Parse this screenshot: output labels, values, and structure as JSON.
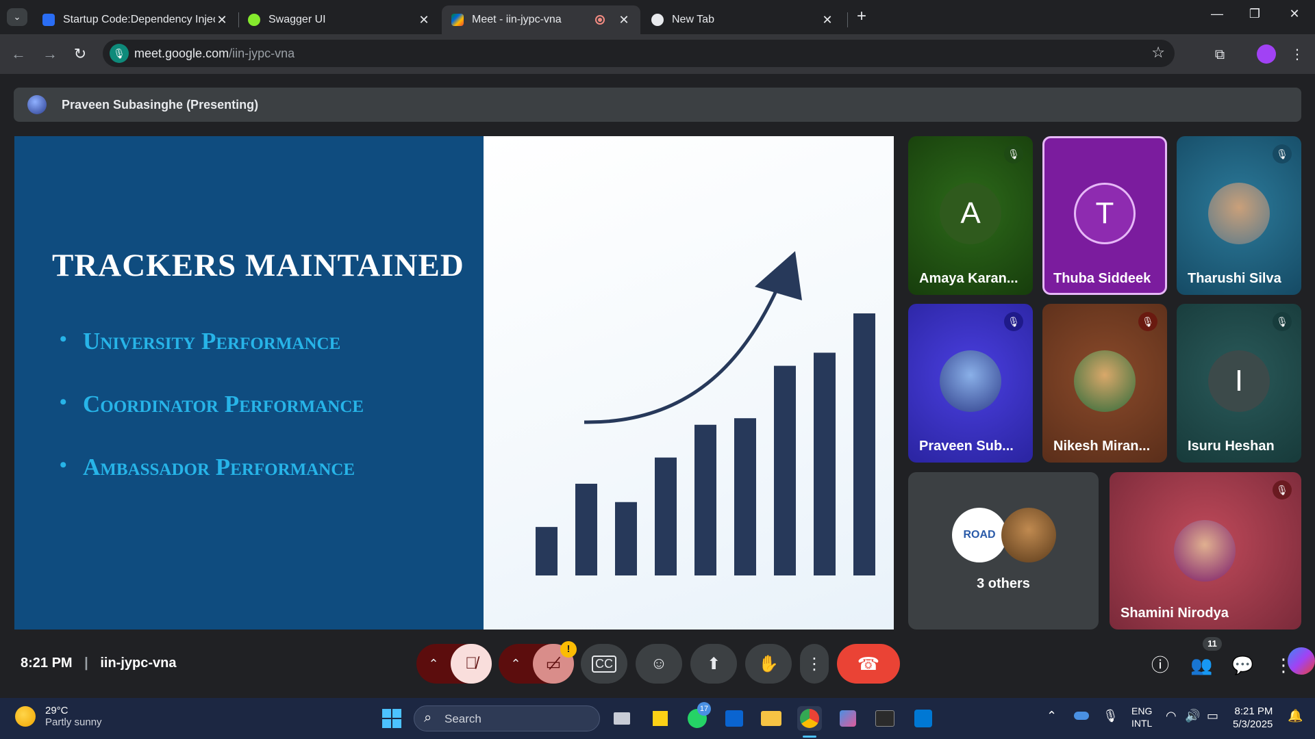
{
  "browser": {
    "tabs": [
      {
        "title": "Startup Code:Dependency Injec",
        "active": false
      },
      {
        "title": "Swagger UI",
        "active": false
      },
      {
        "title": "Meet - iin-jypc-vna",
        "active": true
      },
      {
        "title": "New Tab",
        "active": false
      }
    ],
    "url_host": "meet.google.com",
    "url_path": "/iin-jypc-vna"
  },
  "meet": {
    "presenter_label": "Praveen Subasinghe (Presenting)",
    "slide": {
      "title": "TRACKERS MAINTAINED",
      "bullets": [
        "University Performance",
        "Coordinator Performance",
        "Ambassador Performance"
      ],
      "bars": [
        0.185,
        0.35,
        0.28,
        0.45,
        0.575,
        0.6,
        0.8,
        0.85,
        1.0
      ]
    },
    "participants": [
      {
        "name": "Amaya Karan...",
        "initial": "A"
      },
      {
        "name": "Thuba Siddeek",
        "initial": "T"
      },
      {
        "name": "Tharushi Silva"
      },
      {
        "name": "Praveen Sub..."
      },
      {
        "name": "Nikesh Miran..."
      },
      {
        "name": "Isuru Heshan",
        "initial": "I"
      },
      {
        "name": "3 others"
      },
      {
        "name": "Shamini Nirodya"
      }
    ],
    "time": "8:21 PM",
    "meeting_code": "iin-jypc-vna",
    "people_count": "11",
    "warning_badge": "!"
  },
  "taskbar": {
    "weather_temp": "29°C",
    "weather_desc": "Partly sunny",
    "search_placeholder": "Search",
    "whatsapp_badge": "17",
    "lang_1": "ENG",
    "lang_2": "INTL",
    "clock_time": "8:21 PM",
    "clock_date": "5/3/2025"
  },
  "colors": {
    "meet_bg": "#202124",
    "end_call": "#ea4335",
    "slide_blue": "#0f4c7f",
    "bullet_cyan": "#27b4e8"
  }
}
